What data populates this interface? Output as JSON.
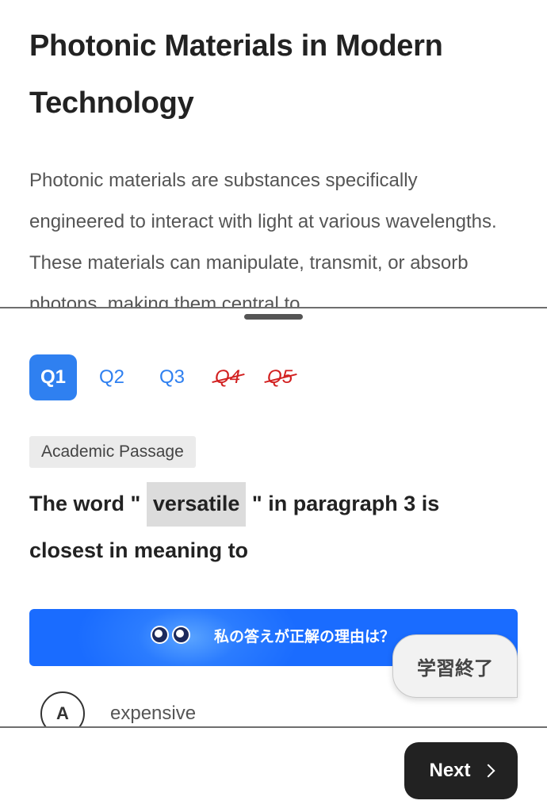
{
  "passage": {
    "title": "Photonic Materials in Modern Technology",
    "body": "Photonic materials are substances specifically engineered to interact with light at various wavelengths. These materials can manipulate, transmit, or absorb photons, making them central to"
  },
  "question_tabs": [
    {
      "label": "Q1",
      "state": "active"
    },
    {
      "label": "Q2",
      "state": "normal"
    },
    {
      "label": "Q3",
      "state": "normal"
    },
    {
      "label": "Q4",
      "state": "struck"
    },
    {
      "label": "Q5",
      "state": "struck"
    }
  ],
  "question": {
    "tag": "Academic Passage",
    "text_before": "The word \" ",
    "highlighted_word": "versatile",
    "text_after": " \" in paragraph 3 is closest in meaning to"
  },
  "reason_banner": {
    "label": "私の答えが正解の理由は？",
    "icon": "eyes-icon"
  },
  "finish_button": {
    "label": "学習終了"
  },
  "options": [
    {
      "letter": "A",
      "text": "expensive"
    }
  ],
  "footer": {
    "next_label": "Next",
    "next_icon": "chevron-right-icon"
  },
  "colors": {
    "accent": "#2f80f0",
    "struck": "#d22020",
    "banner": "#1a6cff",
    "next_button": "#222222"
  }
}
